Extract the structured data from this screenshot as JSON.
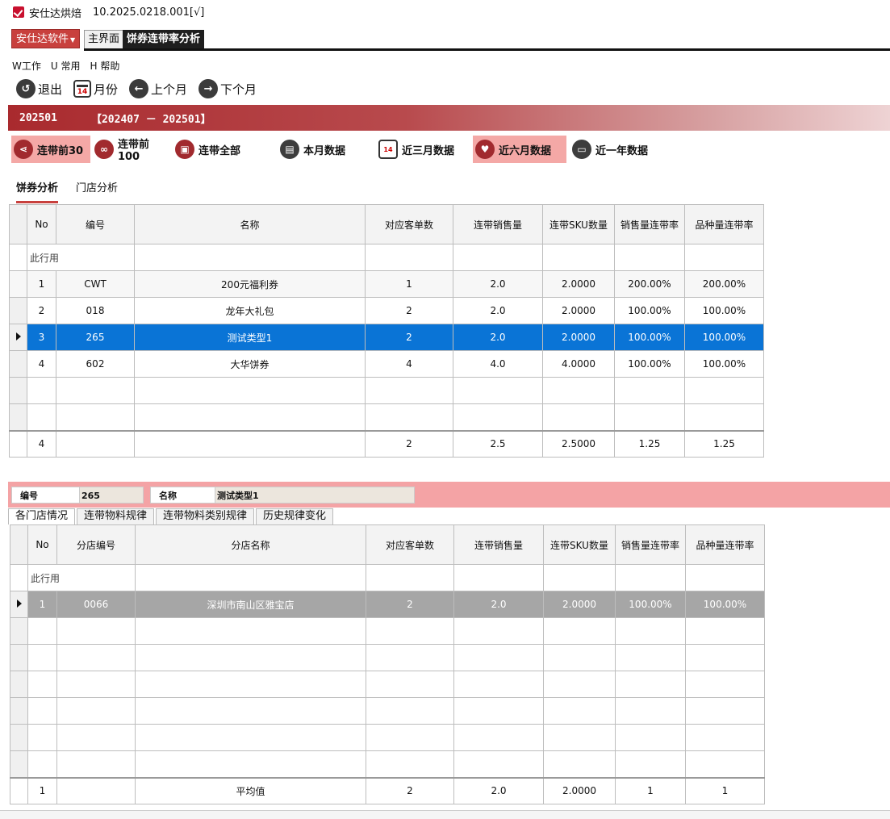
{
  "window": {
    "title": "安仕达烘焙",
    "version": "10.2025.0218.001[√]"
  },
  "tabs": {
    "brand": "安仕达软件",
    "home": "主界面",
    "active": "饼券连带率分析"
  },
  "menu": [
    "W工作",
    "U 常用",
    "H 帮助"
  ],
  "toolbar": {
    "exit": "退出",
    "month": "月份",
    "prev": "上个月",
    "next": "下个月",
    "cal_day": "14"
  },
  "period": {
    "current": "202501",
    "range": "【202407 － 202501】"
  },
  "filters": [
    "连带前30",
    "连带前100",
    "连带全部",
    "本月数据",
    "近三月数据",
    "近六月数据",
    "近一年数据"
  ],
  "subtabs": [
    "饼券分析",
    "门店分析"
  ],
  "grid1": {
    "headers": [
      "No",
      "编号",
      "名称",
      "对应客单数",
      "连带销售量",
      "连带SKU数量",
      "销售量连带率",
      "品种量连带率"
    ],
    "filter_hint": "此行用",
    "rows": [
      [
        "1",
        "CWT",
        "200元福利券",
        "1",
        "2.0",
        "2.0000",
        "200.00%",
        "200.00%"
      ],
      [
        "2",
        "018",
        "龙年大礼包",
        "2",
        "2.0",
        "2.0000",
        "100.00%",
        "100.00%"
      ],
      [
        "3",
        "265",
        "测试类型1",
        "2",
        "2.0",
        "2.0000",
        "100.00%",
        "100.00%"
      ],
      [
        "4",
        "602",
        "大华饼券",
        "4",
        "4.0",
        "4.0000",
        "100.00%",
        "100.00%"
      ]
    ],
    "footer": [
      "4",
      "",
      "",
      "2",
      "2.5",
      "2.5000",
      "1.25",
      "1.25"
    ]
  },
  "detail": {
    "code_label": "编号",
    "code_value": "265",
    "name_label": "名称",
    "name_value": "测试类型1"
  },
  "lower_tabs": [
    "各门店情况",
    "连带物料规律",
    "连带物料类别规律",
    "历史规律变化"
  ],
  "grid2": {
    "headers": [
      "No",
      "分店编号",
      "分店名称",
      "对应客单数",
      "连带销售量",
      "连带SKU数量",
      "销售量连带率",
      "品种量连带率"
    ],
    "filter_hint": "此行用",
    "rows": [
      [
        "1",
        "0066",
        "深圳市南山区雅宝店",
        "2",
        "2.0",
        "2.0000",
        "100.00%",
        "100.00%"
      ]
    ],
    "footer": [
      "1",
      "",
      "平均值",
      "2",
      "2.0",
      "2.0000",
      "1",
      "1"
    ]
  }
}
